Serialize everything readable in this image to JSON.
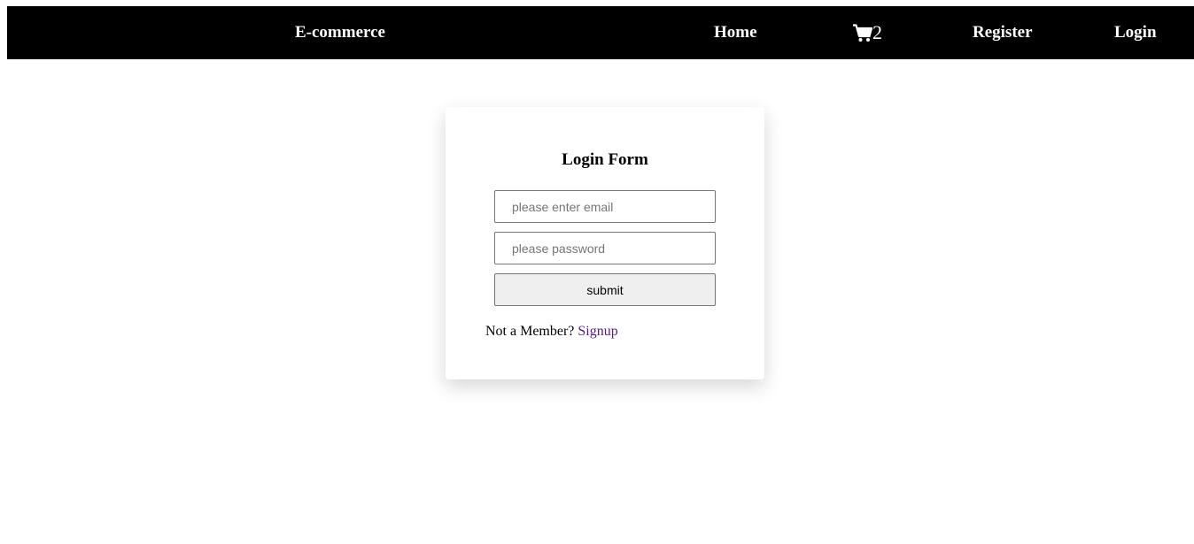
{
  "navbar": {
    "brand": "E-commerce",
    "home_label": "Home",
    "cart_icon": "shopping-cart-icon",
    "cart_count": "2",
    "register_label": "Register",
    "login_label": "Login",
    "background": "#000000",
    "text_color": "#ffffff"
  },
  "login_form": {
    "title": "Login Form",
    "email_value": "",
    "email_placeholder": "please enter email",
    "password_value": "",
    "password_placeholder": "please password",
    "submit_label": "submit",
    "member_prompt": "Not a Member?",
    "signup_label": "Signup",
    "link_color": "#551a8b"
  }
}
